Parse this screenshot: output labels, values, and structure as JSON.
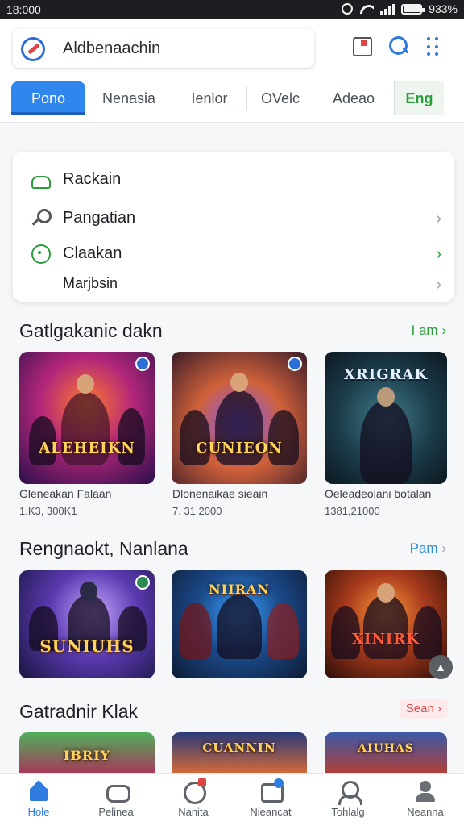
{
  "status_bar": {
    "time": "18:000",
    "battery": "933%"
  },
  "header": {
    "search_text": "Aldbenaachin",
    "tabs": [
      "Pono",
      "Nenasia",
      "Ienlor",
      "OVelc",
      "Adeao",
      "Eng"
    ],
    "active_tab": 0
  },
  "quick_card": {
    "items": [
      {
        "label": "Rackain",
        "icon": "cloud-icon"
      },
      {
        "label": "Pangatian",
        "icon": "wrench-icon"
      },
      {
        "label": "Claakan",
        "icon": "clock-icon"
      },
      {
        "label": "Marjbsin",
        "icon": ""
      }
    ]
  },
  "sections": [
    {
      "title": "Gatlgakanic dakn",
      "see_all": "I am",
      "see_all_color": "#2a9d3a",
      "tiles": [
        {
          "art_title": "ALEHEIKN",
          "caption": "Gleneakan Falaan",
          "count": "1.K3, 300K1"
        },
        {
          "art_title": "CUNIEON",
          "caption": "Dlonenaikae sieain",
          "count": "7. 31 2000"
        },
        {
          "art_title": "XRIGRAK",
          "caption": "Oeleadeolani botalan",
          "count": "1381,21000"
        }
      ]
    },
    {
      "title": "Rengnaokt, Nanlana",
      "see_all": "Pam",
      "see_all_color": "#2f8fd8",
      "tiles": [
        {
          "art_title": "SUNIUHS",
          "caption": "",
          "count": ""
        },
        {
          "art_title": "NIIRAN",
          "caption": "",
          "count": ""
        },
        {
          "art_title": "XINIRK",
          "caption": "",
          "count": ""
        }
      ]
    },
    {
      "title": "Gatradnir Klak",
      "see_all": "Sean",
      "see_all_color": "#e04b4b",
      "tiles": [
        {
          "art_title": "IBRIY",
          "caption": "",
          "count": ""
        },
        {
          "art_title": "CUANNIN",
          "caption": "",
          "count": ""
        },
        {
          "art_title": "AIUHAS",
          "caption": "",
          "count": ""
        }
      ]
    }
  ],
  "bottom_nav": [
    {
      "label": "Hole",
      "icon": "home-icon"
    },
    {
      "label": "Pelinea",
      "icon": "gamepad-icon"
    },
    {
      "label": "Nanita",
      "icon": "ball-icon"
    },
    {
      "label": "Nieancat",
      "icon": "chat-icon"
    },
    {
      "label": "Tohlalg",
      "icon": "person-icon"
    },
    {
      "label": "Neanna",
      "icon": "profile-icon"
    }
  ],
  "colors": {
    "accent": "#2f86ec",
    "green": "#2a9d3a",
    "red": "#e04b4b"
  }
}
